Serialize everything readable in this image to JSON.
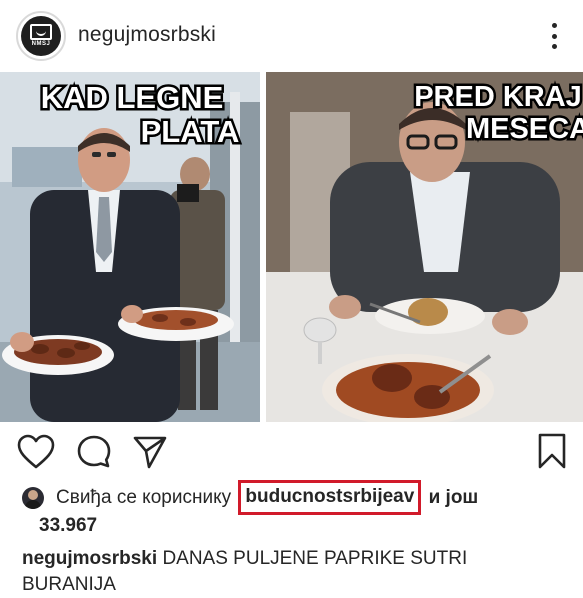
{
  "header": {
    "avatar_logo_text": "NMSJ",
    "username": "negujmosrbski"
  },
  "post": {
    "left_caption_line1": "KAD LEGNE",
    "left_caption_line2": "PLATA",
    "right_caption_line1": "PRED KRAJ",
    "right_caption_line2": "MESECA"
  },
  "actions": {
    "icons": [
      "heart-icon",
      "comment-icon",
      "share-icon",
      "bookmark-icon"
    ]
  },
  "likes": {
    "prefix": "Свиђа се кориснику",
    "user": "buducnostsrbijeav",
    "suffix": "и још",
    "count": "33.967",
    "highlight_color": "#d11a2a"
  },
  "caption": {
    "username": "negujmosrbski",
    "text": "DANAS PULJENE PAPRIKE SUTRI BURANIJA"
  }
}
